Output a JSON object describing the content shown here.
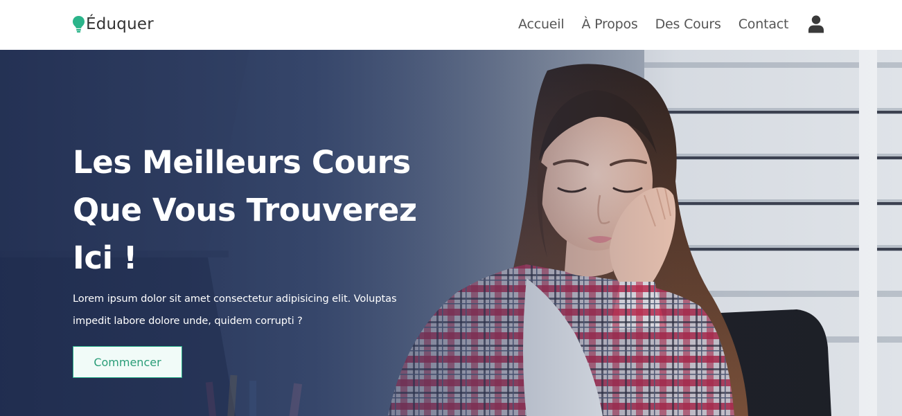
{
  "header": {
    "brand": "Éduquer",
    "brand_color": "#2bb48a",
    "nav": [
      {
        "label": "Accueil"
      },
      {
        "label": "À Propos"
      },
      {
        "label": "Des Cours"
      },
      {
        "label": "Contact"
      }
    ],
    "user_icon": "user-icon"
  },
  "hero": {
    "title_lines": [
      "Les Meilleurs Cours",
      "Que Vous Trouverez",
      "Ici !"
    ],
    "description_lines": [
      "Lorem ipsum dolor sit amet consectetur adipisicing elit. Voluptas",
      "impedit labore dolore unde, quidem corrupti ?"
    ],
    "cta_label": "Commencer",
    "image": "girl-studying-photo",
    "accent_color": "#29b28a"
  }
}
